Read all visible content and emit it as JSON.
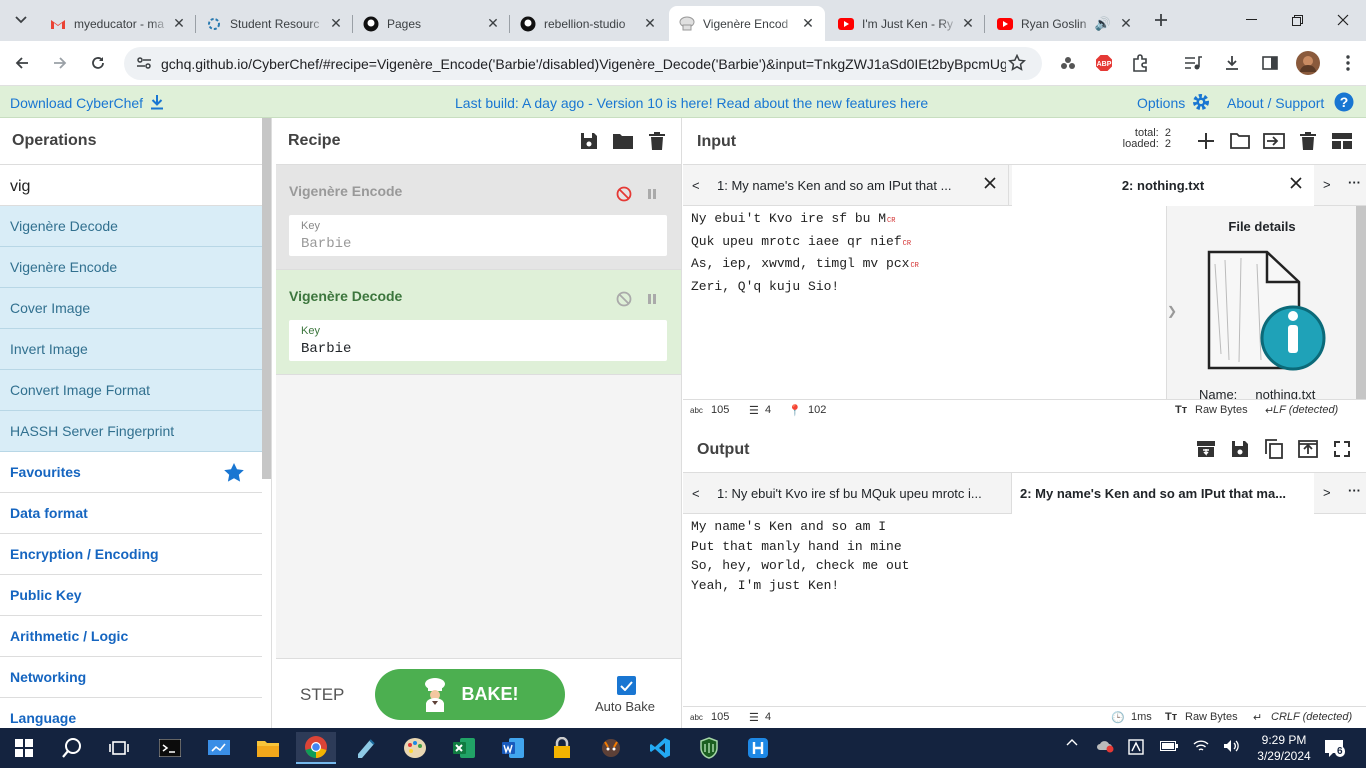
{
  "browser": {
    "tabs": [
      {
        "title": "myeducator - ma",
        "icon": "gmail-icon"
      },
      {
        "title": "Student Resourc",
        "icon": "resource-icon"
      },
      {
        "title": "Pages",
        "icon": "github-icon"
      },
      {
        "title": "rebellion-studio",
        "icon": "github-icon"
      },
      {
        "title": "Vigenère Encod",
        "icon": "cyberchef-icon",
        "active": true
      },
      {
        "title": "I'm Just Ken - Ry",
        "icon": "youtube-icon"
      },
      {
        "title": "Ryan Goslin",
        "icon": "youtube-icon"
      }
    ],
    "url": "gchq.github.io/CyberChef/#recipe=Vigenère_Encode('Barbie'/disabled)Vigenère_Decode('Barbie')&input=TnkgZWJ1aSd0IEt2byBpcmUgMw..."
  },
  "banner": {
    "download": "Download CyberChef",
    "message": "Last build: A day ago - Version 10 is here! Read about the new features here",
    "options": "Options",
    "about": "About / Support"
  },
  "operations": {
    "title": "Operations",
    "search": "vig",
    "results": [
      "Vigenère Decode",
      "Vigenère Encode",
      "Cover Image",
      "Invert Image",
      "Convert Image Format",
      "HASSH Server Fingerprint"
    ],
    "categories": [
      "Favourites",
      "Data format",
      "Encryption / Encoding",
      "Public Key",
      "Arithmetic / Logic",
      "Networking",
      "Language"
    ]
  },
  "recipe": {
    "title": "Recipe",
    "ops": [
      {
        "name": "Vigenère Encode",
        "key_label": "Key",
        "key": "Barbie",
        "disabled": true
      },
      {
        "name": "Vigenère Decode",
        "key_label": "Key",
        "key": "Barbie",
        "disabled": false
      }
    ],
    "step": "STEP",
    "bake": "BAKE!",
    "auto_bake": "Auto Bake"
  },
  "input": {
    "title": "Input",
    "total_label": "total:",
    "total": "2",
    "loaded_label": "loaded:",
    "loaded": "2",
    "tab1": "1: My name's Ken and so am IPut that ...",
    "tab2": "2: nothing.txt",
    "lines": [
      "Ny ebui't Kvo ire sf bu M",
      "Quk upeu mrotc iaee qr nief",
      "As, iep, xwvmd, timgl mv pcx",
      "Zeri, Q'q kuju Sio!"
    ],
    "cr": "CR",
    "file_details": "File details",
    "name_label": "Name:",
    "name_value": "nothing.txt",
    "status": {
      "length": "105",
      "lines": "4",
      "position": "102",
      "chr_enc": "Raw Bytes",
      "eol": "LF (detected)"
    }
  },
  "output": {
    "title": "Output",
    "tab1": "1: Ny ebui't Kvo ire sf bu MQuk upeu mrotc i...",
    "tab2": "2: My name's Ken and so am IPut that ma...",
    "lines": [
      "My name's Ken and so am I",
      "Put that manly hand in mine",
      "So, hey, world, check me out",
      "Yeah, I'm just Ken!"
    ],
    "status": {
      "length": "105",
      "lines": "4",
      "time": "1ms",
      "chr_enc": "Raw Bytes",
      "eol": "CRLF (detected)"
    }
  },
  "taskbar": {
    "time": "9:29 PM",
    "date": "3/29/2024",
    "notifications": "6"
  }
}
